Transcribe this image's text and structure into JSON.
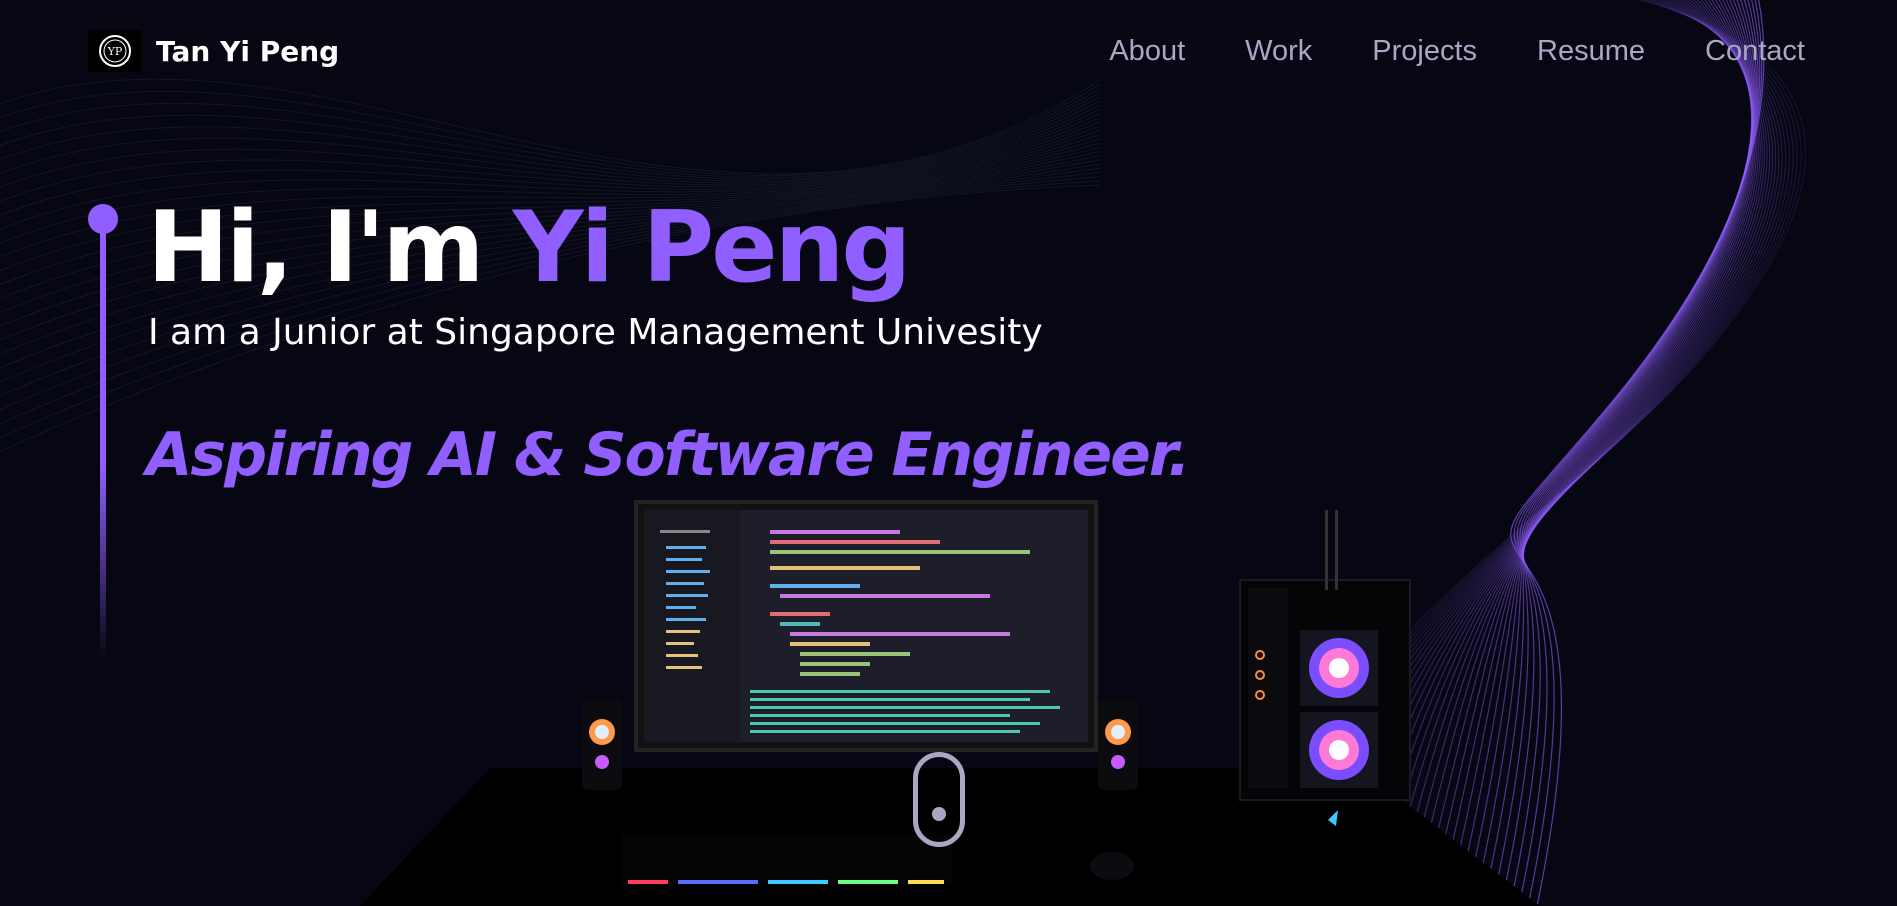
{
  "brand": {
    "logo_monogram": "YP",
    "name": "Tan Yi Peng"
  },
  "nav": {
    "items": [
      {
        "label": "About"
      },
      {
        "label": "Work"
      },
      {
        "label": "Projects"
      },
      {
        "label": "Resume"
      },
      {
        "label": "Contact"
      }
    ]
  },
  "hero": {
    "greeting": "Hi, I'm ",
    "name": "Yi Peng",
    "subtitle": "I am a Junior at Singapore Management Univesity",
    "tagline_plain": "Aspiring ",
    "tagline_emphasis": "AI & Software Engineer."
  },
  "icons": {
    "logo": "yp-logo-icon",
    "scroll": "mouse-scroll-icon"
  },
  "colors": {
    "background": "#060712",
    "accent": "#915eff",
    "nav_text": "#aaa6c3",
    "text": "#ffffff"
  }
}
